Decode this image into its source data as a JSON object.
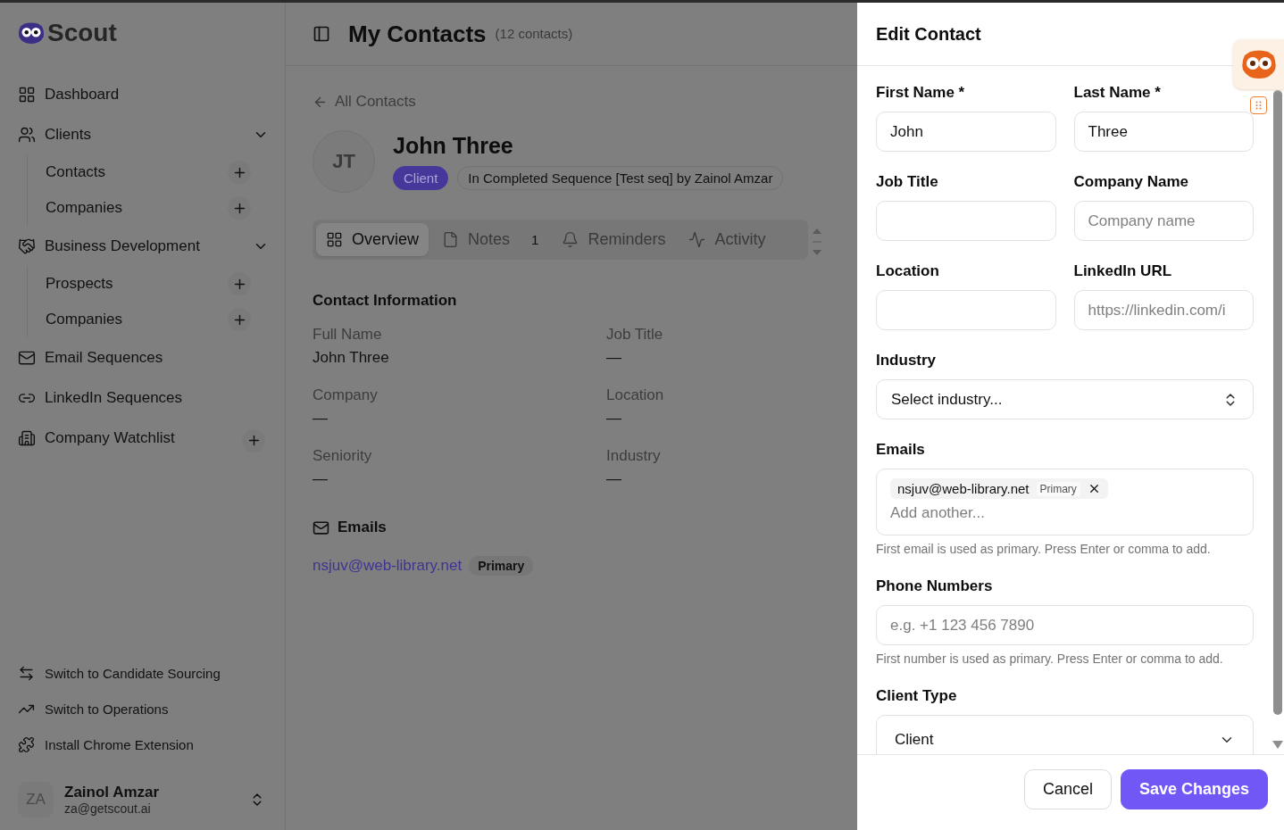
{
  "sidebar": {
    "logo": "Scout",
    "nav": [
      {
        "kind": "link",
        "label": "Dashboard"
      },
      {
        "kind": "group",
        "label": "Clients",
        "expanded": true,
        "children": [
          {
            "label": "Contacts"
          },
          {
            "label": "Companies"
          }
        ]
      },
      {
        "kind": "group",
        "label": "Business Development",
        "expanded": true,
        "children": [
          {
            "label": "Prospects"
          },
          {
            "label": "Companies"
          }
        ]
      },
      {
        "kind": "link",
        "label": "Email Sequences"
      },
      {
        "kind": "link",
        "label": "LinkedIn Sequences"
      },
      {
        "kind": "addable",
        "label": "Company Watchlist"
      }
    ],
    "footer_links": [
      {
        "label": "Switch to Candidate Sourcing"
      },
      {
        "label": "Switch to Operations"
      },
      {
        "label": "Install Chrome Extension"
      }
    ],
    "user": {
      "initials": "ZA",
      "name": "Zainol Amzar",
      "email": "za@getscout.ai"
    }
  },
  "main": {
    "title": "My Contacts",
    "count": "(12 contacts)",
    "back_link": "All Contacts",
    "contact": {
      "initials": "JT",
      "name": "John Three",
      "badges": [
        {
          "kind": "type",
          "label": "Client"
        },
        {
          "kind": "status",
          "label": "In Completed Sequence [Test seq] by Zainol Amzar"
        }
      ]
    },
    "tabs": [
      {
        "label": "Overview",
        "selected": true
      },
      {
        "label": "Notes",
        "count": "1",
        "selected": false
      },
      {
        "label": "Reminders",
        "selected": false
      },
      {
        "label": "Activity",
        "selected": false
      }
    ],
    "contact_information": {
      "title": "Contact Information",
      "fields": [
        {
          "label": "Full Name",
          "value": "John Three"
        },
        {
          "label": "Job Title",
          "value": "—"
        },
        {
          "label": "Company",
          "value": "—"
        },
        {
          "label": "Location",
          "value": "—"
        },
        {
          "label": "Seniority",
          "value": "—"
        },
        {
          "label": "Industry",
          "value": "—"
        }
      ]
    },
    "emails": {
      "title": "Emails",
      "items": [
        {
          "address": "nsjuv@web-library.net",
          "badge": "Primary"
        }
      ]
    }
  },
  "drawer": {
    "title": "Edit Contact",
    "rows": [
      [
        {
          "kind": "text",
          "label": "First Name *",
          "value": "John"
        },
        {
          "kind": "text",
          "label": "Last Name *",
          "value": "Three"
        }
      ],
      [
        {
          "kind": "text",
          "label": "Job Title"
        },
        {
          "kind": "text",
          "label": "Company Name",
          "placeholder": "Company name"
        }
      ],
      [
        {
          "kind": "text",
          "label": "Location"
        },
        {
          "kind": "text",
          "label": "LinkedIn URL",
          "placeholder": "https://linkedin.com/i"
        }
      ],
      [
        {
          "kind": "combobox",
          "label": "Industry",
          "value": "Select industry..."
        }
      ],
      [
        {
          "kind": "tags",
          "label": "Emails",
          "tags": [
            {
              "label": "nsjuv@web-library.net",
              "badge": "Primary"
            }
          ],
          "placeholder": "Add another...",
          "hint": "First email is used as primary. Press Enter or comma to add."
        }
      ],
      [
        {
          "kind": "text",
          "label": "Phone Numbers",
          "placeholder": "e.g. +1 123 456 7890",
          "hint": "First number is used as primary. Press Enter or comma to add."
        }
      ],
      [
        {
          "kind": "select",
          "label": "Client Type",
          "value": "Client"
        }
      ]
    ],
    "buttons": [
      {
        "kind": "secondary",
        "label": "Cancel"
      },
      {
        "kind": "primary",
        "label": "Save Changes"
      }
    ]
  }
}
